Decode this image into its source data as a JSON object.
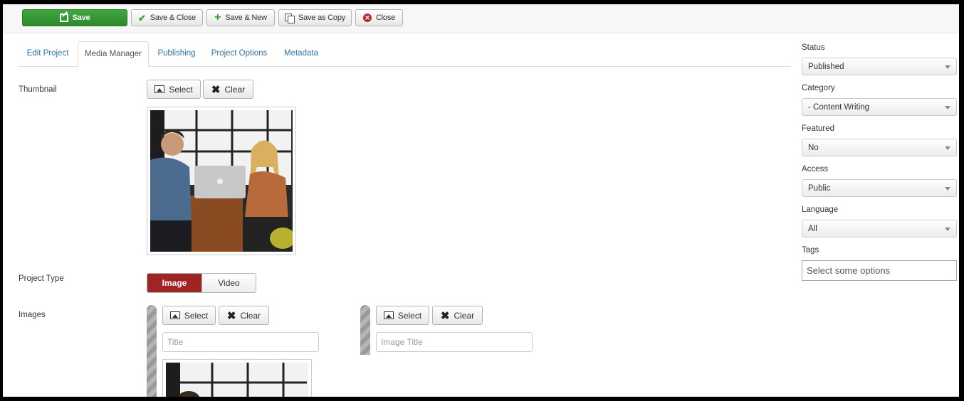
{
  "toolbar": {
    "save": "Save",
    "save_close": "Save & Close",
    "save_new": "Save & New",
    "save_copy": "Save as Copy",
    "close": "Close"
  },
  "tabs": [
    {
      "label": "Edit Project",
      "active": false
    },
    {
      "label": "Media Manager",
      "active": true
    },
    {
      "label": "Publishing",
      "active": false
    },
    {
      "label": "Project Options",
      "active": false
    },
    {
      "label": "Metadata",
      "active": false
    }
  ],
  "thumbnail": {
    "label": "Thumbnail",
    "select": "Select",
    "clear": "Clear"
  },
  "project_type": {
    "label": "Project Type",
    "options": [
      "Image",
      "Video"
    ],
    "selected": "Image"
  },
  "images": {
    "label": "Images",
    "items": [
      {
        "select": "Select",
        "clear": "Clear",
        "title_placeholder": "Title"
      },
      {
        "select": "Select",
        "clear": "Clear",
        "title_placeholder": "Image Title"
      }
    ]
  },
  "sidebar": {
    "status": {
      "label": "Status",
      "value": "Published"
    },
    "category": {
      "label": "Category",
      "value": "- Content Writing"
    },
    "featured": {
      "label": "Featured",
      "value": "No"
    },
    "access": {
      "label": "Access",
      "value": "Public"
    },
    "language": {
      "label": "Language",
      "value": "All"
    },
    "tags": {
      "label": "Tags",
      "placeholder": "Select some options"
    }
  },
  "colors": {
    "save_green": "#2d8a2d",
    "active_red": "#a12424",
    "link_blue": "#3071a9"
  }
}
